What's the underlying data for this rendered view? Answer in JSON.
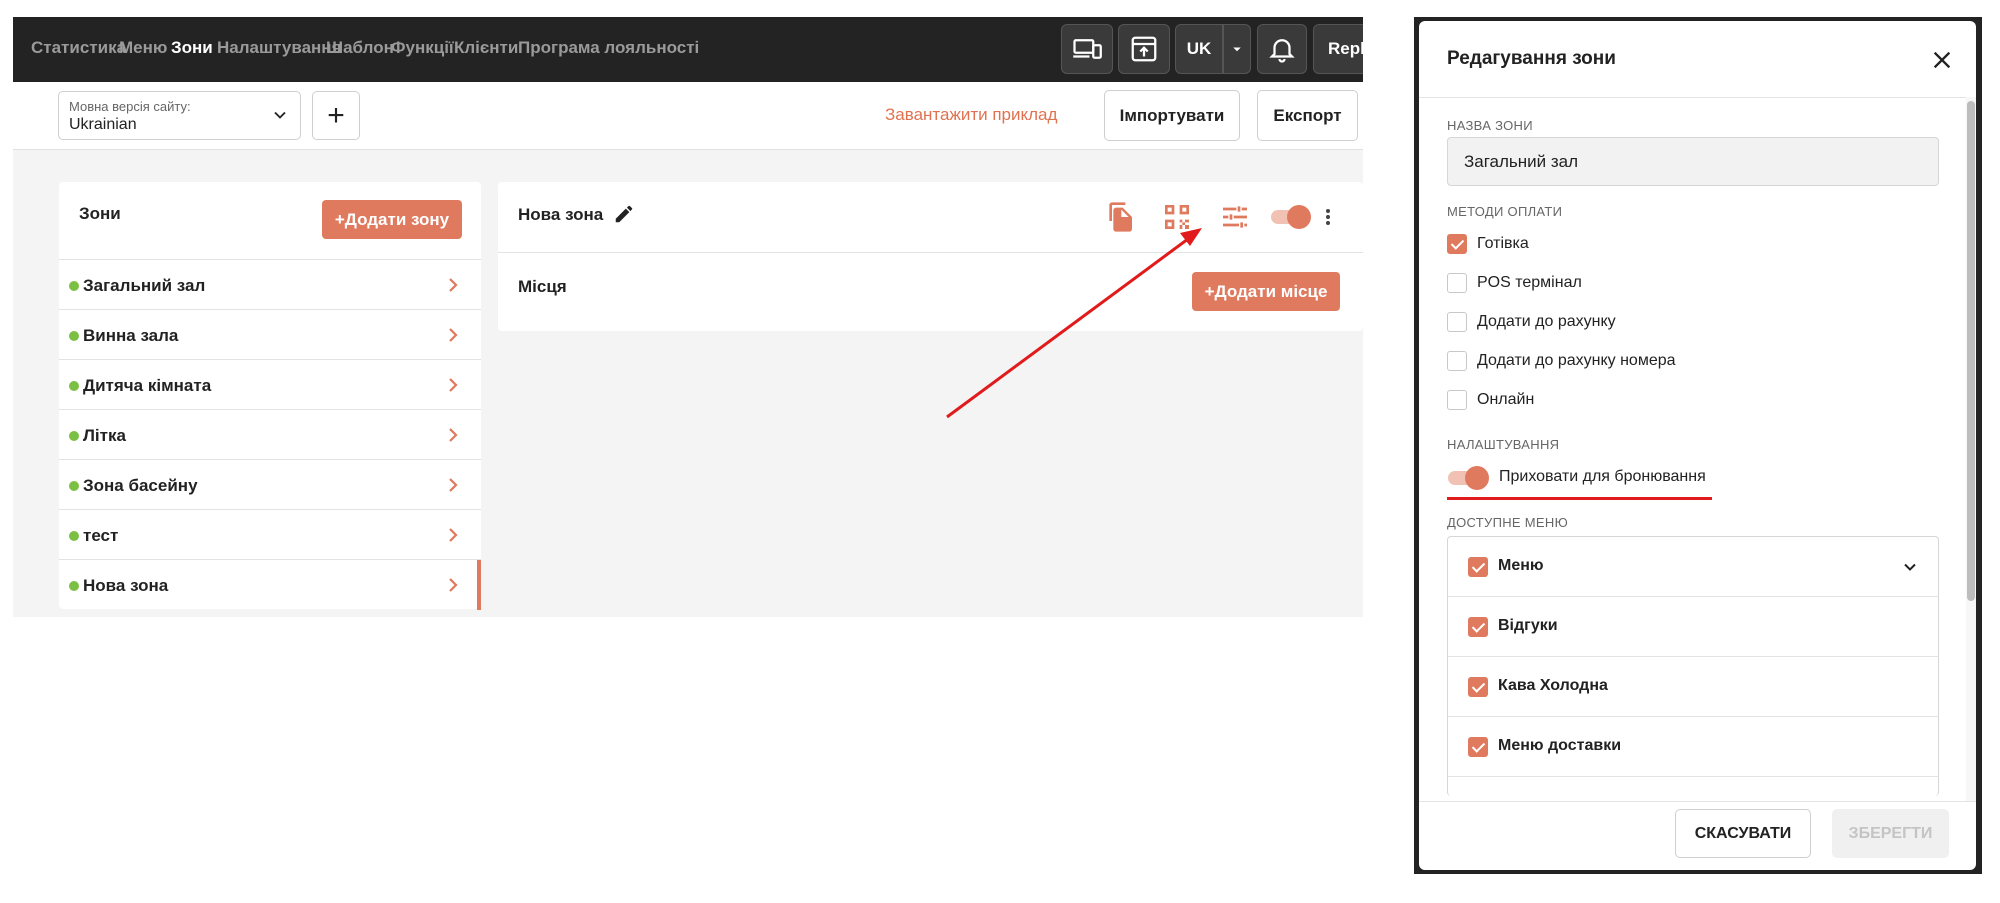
{
  "nav": {
    "items": [
      "Статистика",
      "Меню",
      "Зони",
      "Налаштування",
      "Шаблон",
      "Функції",
      "Клієнти",
      "Програма лояльності"
    ],
    "active": "Зони",
    "lang_button": "UK",
    "user_partial": "Repk"
  },
  "toolbar": {
    "lang_select_label": "Мовна версія сайту:",
    "lang_select_value": "Ukrainian",
    "add_lang": "+",
    "download_example": "Завантажити приклад",
    "import": "Імпортувати",
    "export": "Експорт"
  },
  "zones": {
    "title": "Зони",
    "add_button": "+Додати зону",
    "items": [
      "Загальний зал",
      "Винна зала",
      "Дитяча кімната",
      "Літка",
      "Зона басейну",
      "тест",
      "Нова зона"
    ],
    "selected": "Нова зона"
  },
  "zone_detail": {
    "name": "Нова зона",
    "places_label": "Місця",
    "add_place_button": "+Додати місце",
    "enabled": true
  },
  "modal": {
    "title": "Редагування зони",
    "zone_name_label": "НАЗВА ЗОНИ",
    "zone_name_value": "Загальний зал",
    "payment_label": "МЕТОДИ ОПЛАТИ",
    "payment_methods": [
      {
        "label": "Готівка",
        "checked": true
      },
      {
        "label": "POS термінал",
        "checked": false
      },
      {
        "label": "Додати до рахунку",
        "checked": false
      },
      {
        "label": "Додати до рахунку номера",
        "checked": false
      },
      {
        "label": "Онлайн",
        "checked": false
      }
    ],
    "settings_label": "НАЛАШТУВАННЯ",
    "hide_booking_label": "Приховати для бронювання",
    "hide_booking_on": true,
    "menus_label": "ДОСТУПНЕ МЕНЮ",
    "menus": [
      {
        "label": "Меню",
        "checked": true
      },
      {
        "label": "Відгуки",
        "checked": true
      },
      {
        "label": "Кава Холодна",
        "checked": true
      },
      {
        "label": "Меню доставки",
        "checked": true
      }
    ],
    "cancel": "СКАСУВАТИ",
    "save": "ЗБЕРЕГТИ"
  },
  "colors": {
    "accent": "#e07a5f",
    "nav_bg": "#232323",
    "status_dot": "#7bc043",
    "annotation": "#e11b1b"
  }
}
